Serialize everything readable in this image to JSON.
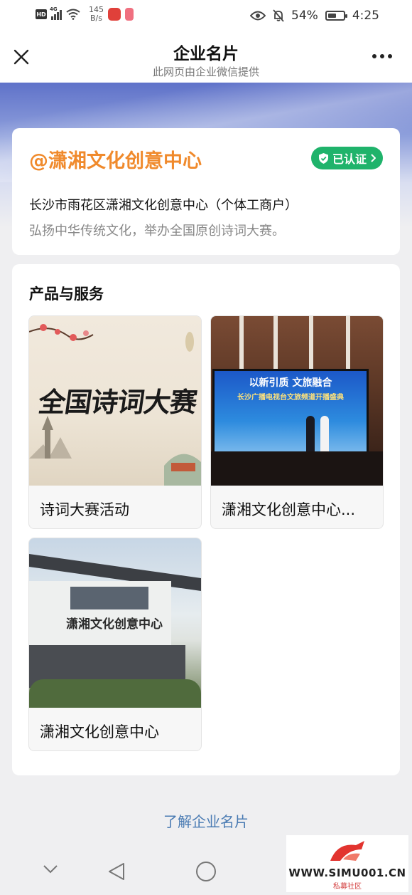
{
  "status_bar": {
    "hd": "HD",
    "network": "4G",
    "speed_value": "145",
    "speed_unit": "B/s",
    "battery_percent": "54%",
    "battery_level": 0.54,
    "time": "4:25"
  },
  "nav": {
    "title": "企业名片",
    "subtitle": "此网页由企业微信提供"
  },
  "company": {
    "name": "@潇湘文化创意中心",
    "verified_label": "已认证",
    "full_name": "长沙市雨花区潇湘文化创意中心（个体工商户）",
    "description": "弘扬中华传统文化，举办全国原创诗词大赛。"
  },
  "products": {
    "section_title": "产品与服务",
    "items": [
      {
        "label": "诗词大赛活动",
        "image_text": "全国诗词大赛"
      },
      {
        "label": "潇湘文化创意中心...",
        "image_text_1": "以新引质 文旅融合",
        "image_text_2": "长沙广播电视台文旅频道开播盛典"
      },
      {
        "label": "潇湘文化创意中心",
        "image_text": "潇湘文化创意中心"
      }
    ]
  },
  "footer": {
    "learn_more": "了解企业名片"
  },
  "watermark": {
    "text": "WWW.SIMU001.CN",
    "sub": "私募社区"
  },
  "colors": {
    "accent_orange": "#f08a2c",
    "verified_green": "#1fb36b",
    "link_blue": "#4a7bb3"
  }
}
